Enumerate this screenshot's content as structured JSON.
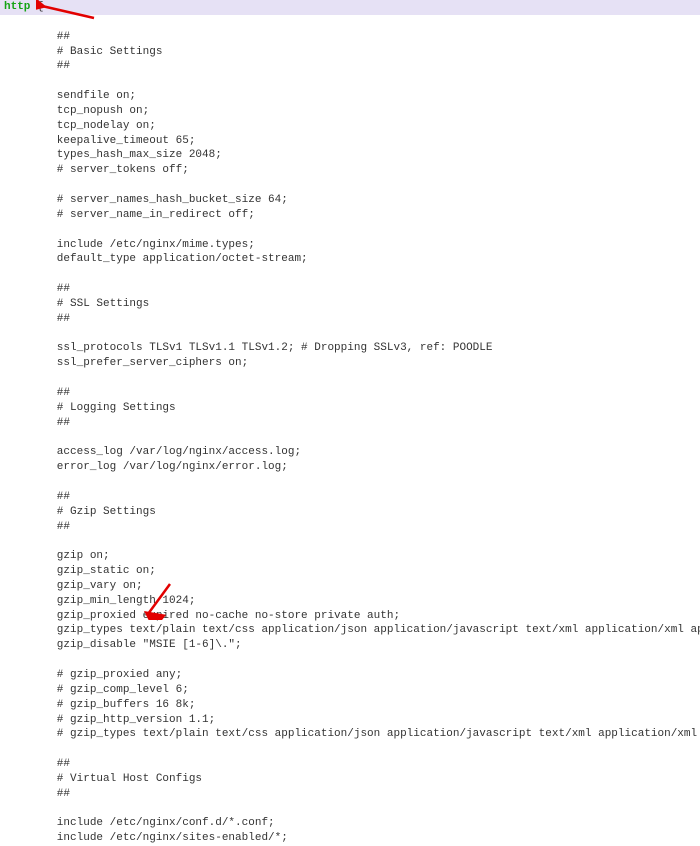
{
  "keyword": "http",
  "brace": " {",
  "lines": [
    "",
    "        ##",
    "        # Basic Settings",
    "        ##",
    "",
    "        sendfile on;",
    "        tcp_nopush on;",
    "        tcp_nodelay on;",
    "        keepalive_timeout 65;",
    "        types_hash_max_size 2048;",
    "        # server_tokens off;",
    "",
    "        # server_names_hash_bucket_size 64;",
    "        # server_name_in_redirect off;",
    "",
    "        include /etc/nginx/mime.types;",
    "        default_type application/octet-stream;",
    "",
    "        ##",
    "        # SSL Settings",
    "        ##",
    "",
    "        ssl_protocols TLSv1 TLSv1.1 TLSv1.2; # Dropping SSLv3, ref: POODLE",
    "        ssl_prefer_server_ciphers on;",
    "",
    "        ##",
    "        # Logging Settings",
    "        ##",
    "",
    "        access_log /var/log/nginx/access.log;",
    "        error_log /var/log/nginx/error.log;",
    "",
    "        ##",
    "        # Gzip Settings",
    "        ##",
    "",
    "        gzip on;",
    "        gzip_static on;",
    "        gzip_vary on;",
    "        gzip_min_length 1024;",
    "        gzip_proxied expired no-cache no-store private auth;",
    "        gzip_types text/plain text/css application/json application/javascript text/xml application/xml application/xml+rss text/javascript;",
    "        gzip_disable \"MSIE [1-6]\\.\";",
    "",
    "        # gzip_proxied any;",
    "        # gzip_comp_level 6;",
    "        # gzip_buffers 16 8k;",
    "        # gzip_http_version 1.1;",
    "        # gzip_types text/plain text/css application/json application/javascript text/xml application/xml application/xml+rss text/javascript;",
    "",
    "        ##",
    "        # Virtual Host Configs",
    "        ##",
    "",
    "        include /etc/nginx/conf.d/*.conf;",
    "        include /etc/nginx/sites-enabled/*;"
  ],
  "annotations": {
    "arrow_top_target": "http directive opening brace",
    "arrow_bottom_target": "include directives"
  }
}
